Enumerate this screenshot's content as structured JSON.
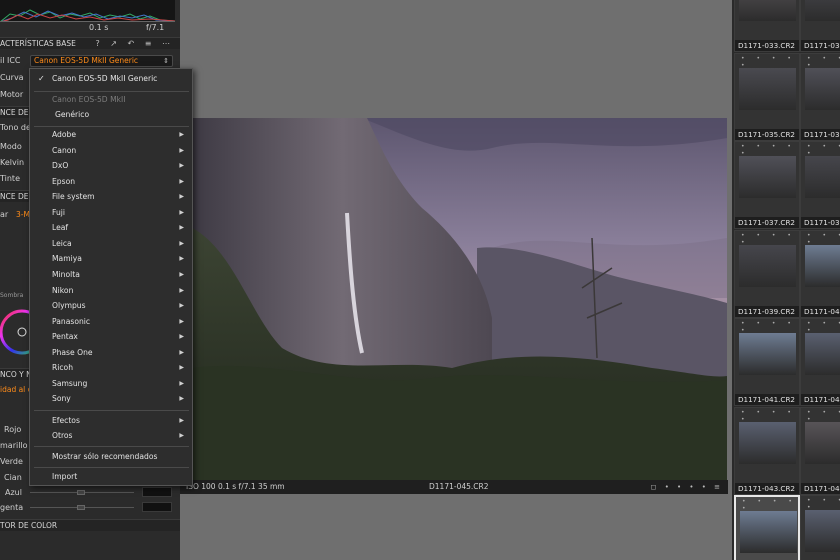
{
  "histogram": {
    "time_left": "0.1 s",
    "time_right": "f/7.1"
  },
  "base_characteristics": {
    "title": "ACTERÍSTICAS BASE",
    "tools": "? ↗ ↶ ≡ ⋯"
  },
  "left_labels": {
    "icc": "il ICC",
    "curve": "Curva",
    "motor": "Motor",
    "wb_section": "NCE DE",
    "tone": "Tono de",
    "mode": "Modo",
    "kelvin": "Kelvin",
    "tint": "Tinte",
    "wb_section2": "NCE DE",
    "adjust": "ar",
    "adjust_tag": "3-M",
    "shadow": "Sombra",
    "bw_section": "NCO Y NE",
    "intensity": "idad al c",
    "red": "Rojo",
    "yellow": "marillo",
    "green": "Verde",
    "cyan": "Cian",
    "blue": "Azul",
    "magenta": "genta",
    "color_section": "TOR DE COLOR"
  },
  "icc_select": {
    "value": "Canon EOS-5D MkII Generic"
  },
  "menu": {
    "checked": "Canon EOS-5D MkII Generic",
    "header_disabled": "Canon EOS-5D MkII",
    "generic": "Genérico",
    "brands": [
      "Adobe",
      "Canon",
      "DxO",
      "Epson",
      "File system",
      "Fuji",
      "Leaf",
      "Leica",
      "Mamiya",
      "Minolta",
      "Nikon",
      "Olympus",
      "Panasonic",
      "Pentax",
      "Phase One",
      "Ricoh",
      "Samsung",
      "Sony"
    ],
    "effects": "Efectos",
    "others": "Otros",
    "recommended": "Mostrar sólo recomendados",
    "import": "Import"
  },
  "viewer": {
    "info": "ISO 100  0.1 s  f/7.1  35 mm",
    "filename": "D1171-045.CR2",
    "right_tools": "◻ • • • • ≡"
  },
  "filmstrip": {
    "left_column": [
      "D1171-033.CR2",
      "D1171-035.CR2",
      "D1171-037.CR2",
      "D1171-039.CR2",
      "D1171-041.CR2",
      "D1171-043.CR2"
    ],
    "right_column": [
      "D1171-034",
      "D1171-036",
      "D1171-038",
      "D1171-040",
      "D1171-042",
      "D1171-044"
    ],
    "dots": "• • • • •"
  }
}
